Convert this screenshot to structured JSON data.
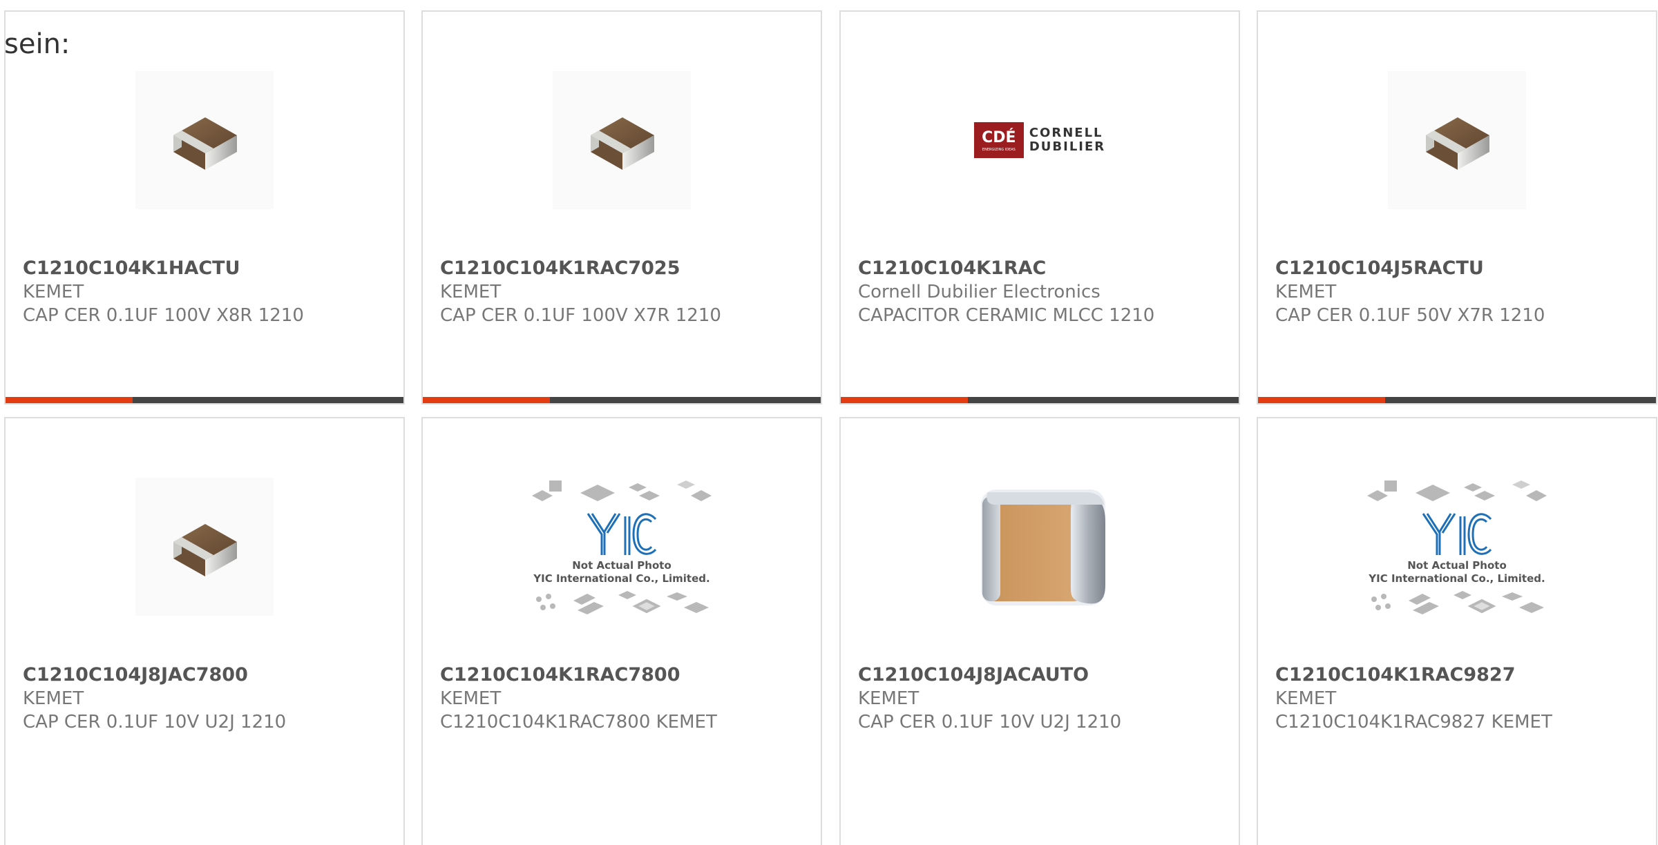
{
  "lead_text": "sein:",
  "products": [
    {
      "part": "C1210C104K1HACTU",
      "maker": "KEMET",
      "desc": "CAP CER 0.1UF 100V X8R 1210",
      "image": "capacitor-chip",
      "progress_fraction": 0.32
    },
    {
      "part": "C1210C104K1RAC7025",
      "maker": "KEMET",
      "desc": "CAP CER 0.1UF 100V X7R 1210",
      "image": "capacitor-chip",
      "progress_fraction": 0.32
    },
    {
      "part": "C1210C104K1RAC",
      "maker": "Cornell Dubilier Electronics",
      "desc": "CAPACITOR CERAMIC MLCC 1210",
      "image": "cde-logo",
      "progress_fraction": 0.32,
      "logo": {
        "mark": "CDÉ",
        "line1": "CORNELL",
        "line2": "DUBILIER",
        "tagline": "ENERGIZING IDEAS"
      }
    },
    {
      "part": "C1210C104J5RACTU",
      "maker": "KEMET",
      "desc": "CAP CER 0.1UF 50V X7R 1210",
      "image": "capacitor-chip",
      "progress_fraction": 0.32
    },
    {
      "part": "C1210C104J8JAC7800",
      "maker": "KEMET",
      "desc": "CAP CER 0.1UF 10V U2J 1210",
      "image": "capacitor-chip"
    },
    {
      "part": "C1210C104K1RAC7800",
      "maker": "KEMET",
      "desc": "C1210C104K1RAC7800 KEMET",
      "image": "yic-placeholder",
      "placeholder": {
        "line1": "Not Actual Photo",
        "line2": "YIC International Co., Limited."
      }
    },
    {
      "part": "C1210C104J8JACAUTO",
      "maker": "KEMET",
      "desc": "CAP CER 0.1UF 10V U2J 1210",
      "image": "capacitor-large"
    },
    {
      "part": "C1210C104K1RAC9827",
      "maker": "KEMET",
      "desc": "C1210C104K1RAC9827 KEMET",
      "image": "yic-placeholder",
      "placeholder": {
        "line1": "Not Actual Photo",
        "line2": "YIC International Co., Limited."
      }
    }
  ],
  "colors": {
    "accent": "#e33b12",
    "bar_track": "#444444",
    "card_border": "#dddddd",
    "cde_red": "#9b1d20",
    "yic_blue": "#1d6fb8"
  }
}
